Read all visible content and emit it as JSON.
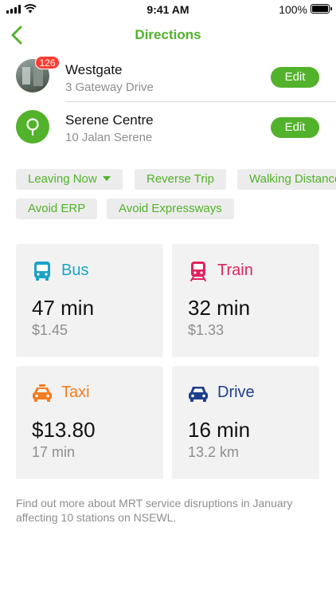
{
  "status_bar": {
    "time": "9:41 AM",
    "battery": "100%"
  },
  "nav": {
    "title": "Directions",
    "back_icon": "chevron-left-icon"
  },
  "origin": {
    "name": "Westgate",
    "address": "3 Gateway Drive",
    "badge": "126",
    "edit_label": "Edit"
  },
  "destination": {
    "name": "Serene Centre",
    "address": "10 Jalan Serene",
    "edit_label": "Edit"
  },
  "options": {
    "leaving": "Leaving Now",
    "reverse": "Reverse Trip",
    "walking": "Walking Distance",
    "avoid_erp": "Avoid ERP",
    "avoid_expressways": "Avoid Expressways"
  },
  "modes": {
    "bus": {
      "label": "Bus",
      "main": "47 min",
      "sub": "$1.45",
      "color": "#1ba3c6",
      "icon": "bus-icon"
    },
    "train": {
      "label": "Train",
      "main": "32 min",
      "sub": "$1.33",
      "color": "#e0245e",
      "icon": "train-icon"
    },
    "taxi": {
      "label": "Taxi",
      "main": "$13.80",
      "sub": "17 min",
      "color": "#f47c20",
      "icon": "taxi-icon"
    },
    "drive": {
      "label": "Drive",
      "main": "16 min",
      "sub": "13.2 km",
      "color": "#1d3f8a",
      "icon": "car-icon"
    }
  },
  "notice": "Find out more about MRT service disruptions in January affecting 10 stations on NSEWL.",
  "colors": {
    "accent": "#52b22b",
    "badge": "#ff3b30"
  }
}
